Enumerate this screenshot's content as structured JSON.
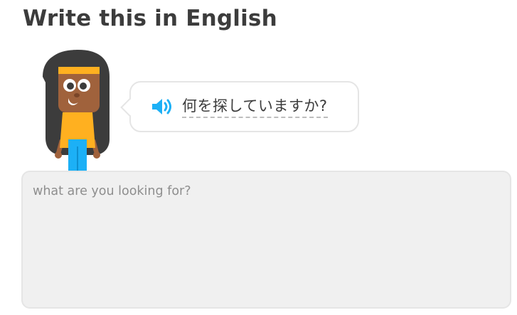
{
  "header": {
    "title": "Write this in English"
  },
  "prompt": {
    "speaker_icon": "speaker-icon",
    "text": "何を探していますか?"
  },
  "answer": {
    "value": "",
    "placeholder": "what are you looking for?"
  },
  "colors": {
    "speaker_blue": "#1cb0f6",
    "hair": "#3c3c3c",
    "skin": "#a0623c",
    "shirt": "#ffb020",
    "pants": "#1cb0f6",
    "headband": "#ffb020",
    "input_bg": "#f0f0f0",
    "border": "#e5e5e5"
  }
}
